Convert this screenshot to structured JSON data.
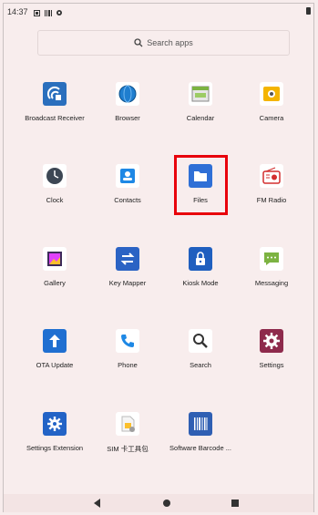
{
  "status_bar": {
    "time": "14:37"
  },
  "search": {
    "placeholder": "Search apps"
  },
  "apps": [
    {
      "label": "Broadcast Receiver",
      "icon": "broadcast-receiver-icon"
    },
    {
      "label": "Browser",
      "icon": "browser-globe-icon"
    },
    {
      "label": "Calendar",
      "icon": "calendar-icon"
    },
    {
      "label": "Camera",
      "icon": "camera-icon"
    },
    {
      "label": "Clock",
      "icon": "clock-icon"
    },
    {
      "label": "Contacts",
      "icon": "contacts-icon"
    },
    {
      "label": "Files",
      "icon": "folder-icon"
    },
    {
      "label": "FM Radio",
      "icon": "radio-icon"
    },
    {
      "label": "Gallery",
      "icon": "gallery-icon"
    },
    {
      "label": "Key Mapper",
      "icon": "key-mapper-icon"
    },
    {
      "label": "Kiosk Mode",
      "icon": "lock-icon"
    },
    {
      "label": "Messaging",
      "icon": "message-icon"
    },
    {
      "label": "OTA Update",
      "icon": "upload-arrow-icon"
    },
    {
      "label": "Phone",
      "icon": "phone-icon"
    },
    {
      "label": "Search",
      "icon": "magnifier-icon"
    },
    {
      "label": "Settings",
      "icon": "gear-icon"
    },
    {
      "label": "Settings Extension",
      "icon": "gear-extension-icon"
    },
    {
      "label": "SIM 卡工具包",
      "icon": "sim-toolkit-icon"
    },
    {
      "label": "Software Barcode ...",
      "icon": "barcode-icon"
    }
  ],
  "colors": {
    "background": "#f8eded",
    "highlight": "#e8000b"
  }
}
